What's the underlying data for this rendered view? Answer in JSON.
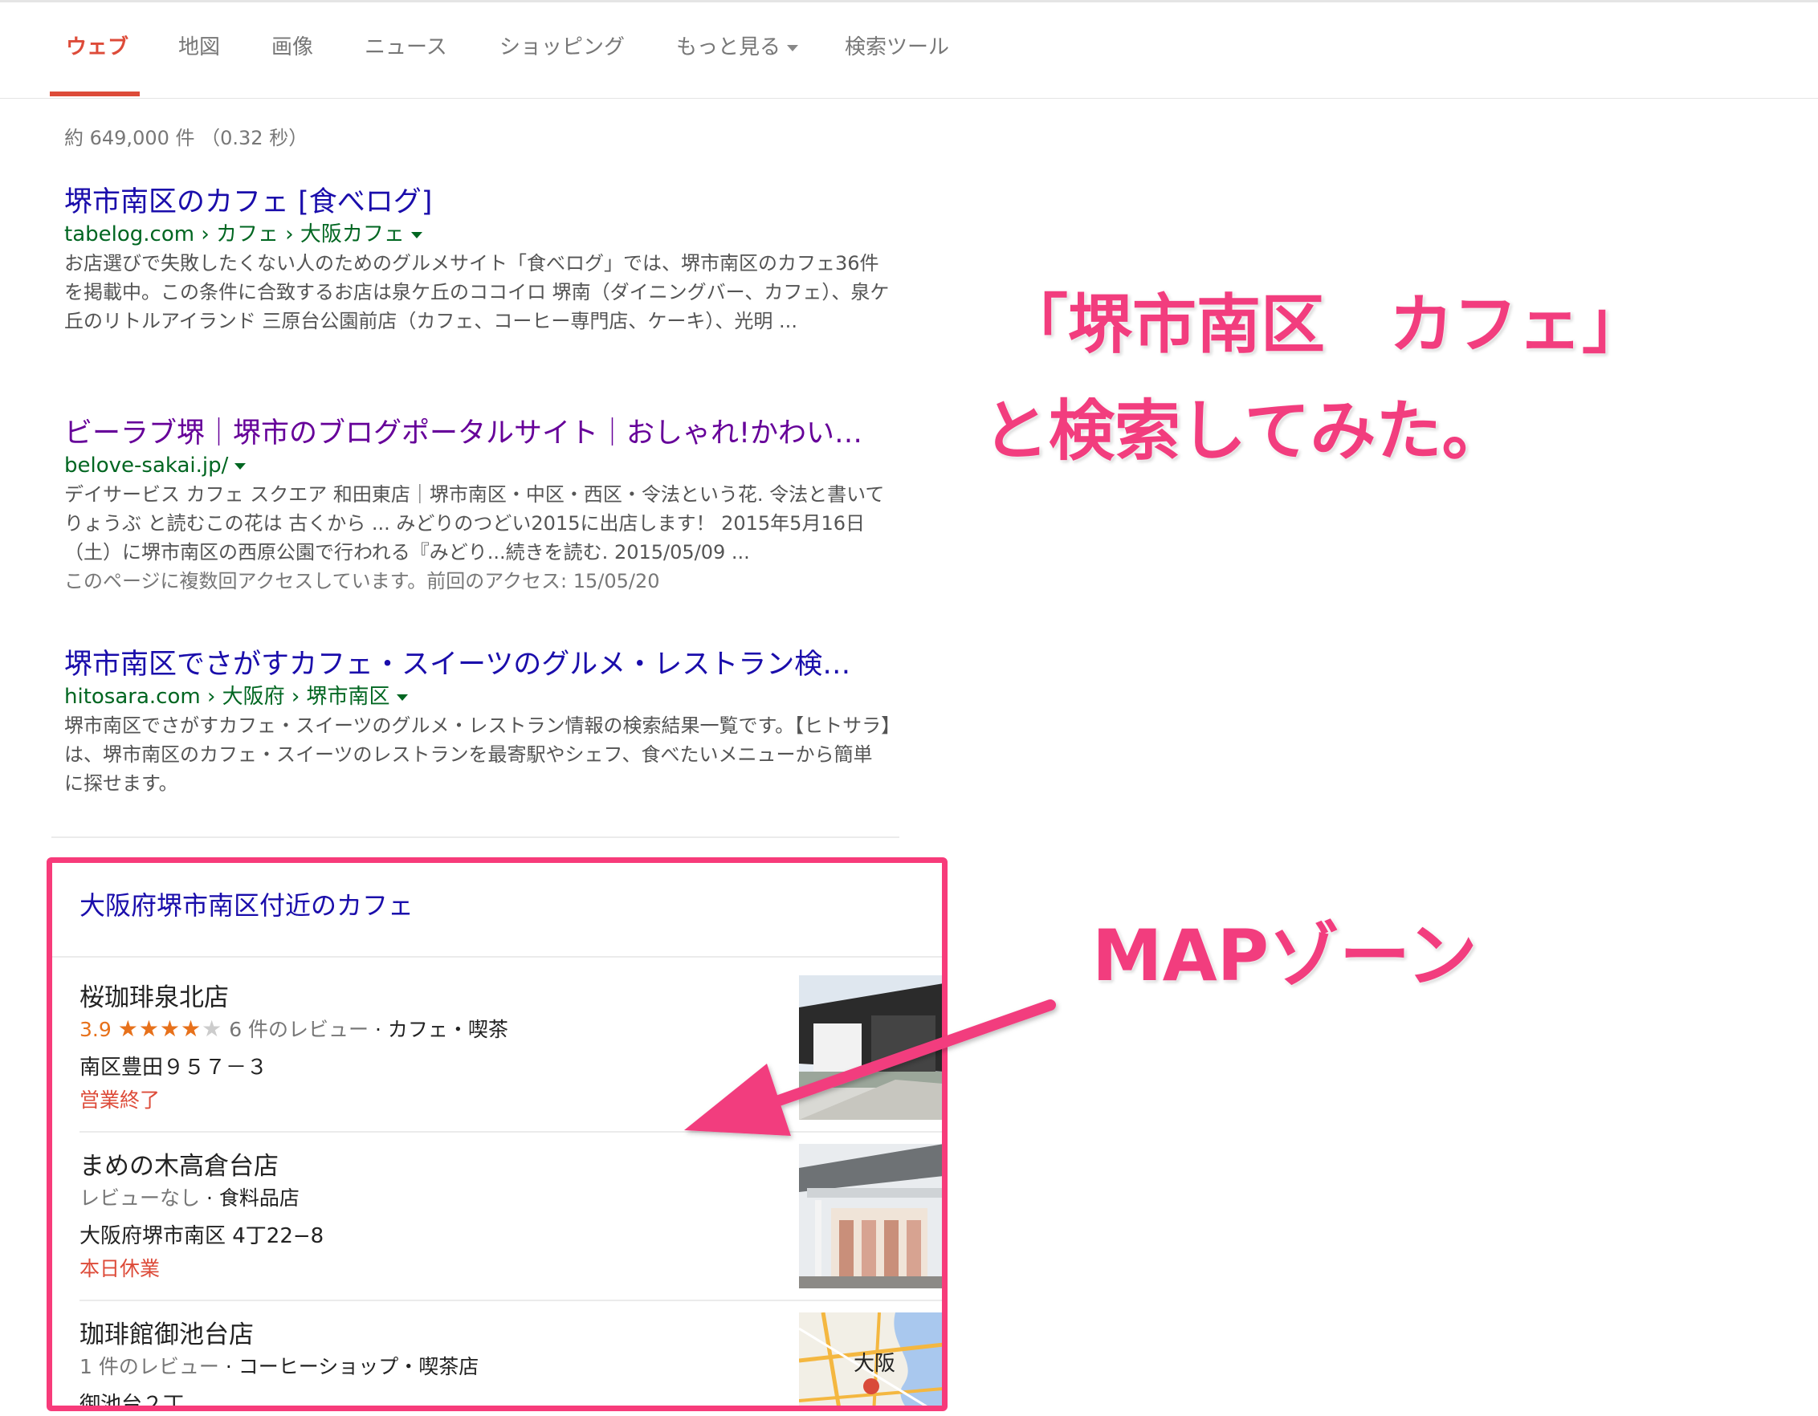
{
  "tabs": [
    {
      "label": "ウェブ",
      "active": true
    },
    {
      "label": "地図"
    },
    {
      "label": "画像"
    },
    {
      "label": "ニュース"
    },
    {
      "label": "ショッピング"
    },
    {
      "label": "もっと見る"
    },
    {
      "label": "検索ツール"
    }
  ],
  "stats": "約 649,000 件 （0.32 秒）",
  "results": [
    {
      "title": "堺市南区のカフェ [食べログ]",
      "url": "tabelog.com › カフェ › 大阪カフェ",
      "snippet": "お店選びで失敗したくない人のためのグルメサイト「食べログ」では、堺市南区のカフェ36件を掲載中。この条件に合致するお店は泉ケ丘のココイロ 堺南（ダイニングバー、カフェ）、泉ケ丘のリトルアイランド 三原台公園前店（カフェ、コーヒー専門店、ケーキ）、光明 ..."
    },
    {
      "title": "ビーラブ堺｜堺市のブログポータルサイト｜おしゃれ!かわい…",
      "url": "belove-sakai.jp/",
      "snippet": "デイサービス カフェ スクエア 和田東店｜堺市南区・中区・西区・令法という花. 令法と書いて りょうぶ と読むこの花は 古くから ... みどりのつどい2015に出店します！ 2015年5月16日（土）に堺市南区の西原公園で行われる『みどり...続きを読む. 2015/05/09 ...",
      "visited_note": "このページに複数回アクセスしています。前回のアクセス: 15/05/20"
    },
    {
      "title": "堺市南区でさがすカフェ・スイーツのグルメ・レストラン検…",
      "url": "hitosara.com › 大阪府 › 堺市南区",
      "snippet": "堺市南区でさがすカフェ・スイーツのグルメ・レストラン情報の検索結果一覧です。【ヒトサラ】は、堺市南区のカフェ・スイーツのレストランを最寄駅やシェフ、食べたいメニューから簡単に探せます。"
    }
  ],
  "local": {
    "title": "大阪府堺市南区付近のカフェ",
    "places": [
      {
        "name": "桜珈琲泉北店",
        "rating": "3.9",
        "stars": 3.9,
        "stars_full": "★★★★",
        "stars_empty": "★",
        "reviews": "6 件のレビュー",
        "category": "カフェ・喫茶",
        "address": "南区豊田９５７－３",
        "status": "営業終了"
      },
      {
        "name": "まめの木高倉台店",
        "reviews": "レビューなし",
        "category": "食料品店",
        "address": "大阪府堺市南区 4丁22−8",
        "status": "本日休業"
      },
      {
        "name": "珈琲館御池台店",
        "reviews": "1 件のレビュー",
        "category": "コーヒーショップ・喫茶店",
        "address": "御池台２丁",
        "map_label": "大阪"
      }
    ]
  },
  "annotations": {
    "line1": "「堺市南区　カフェ」",
    "line2": "と検索してみた。",
    "map_zone": "MAPゾーン"
  },
  "colors": {
    "accent": "#dd4b39",
    "link": "#1a0dab",
    "visited": "#660099",
    "url": "#006621",
    "annotation": "#f23d7e"
  }
}
